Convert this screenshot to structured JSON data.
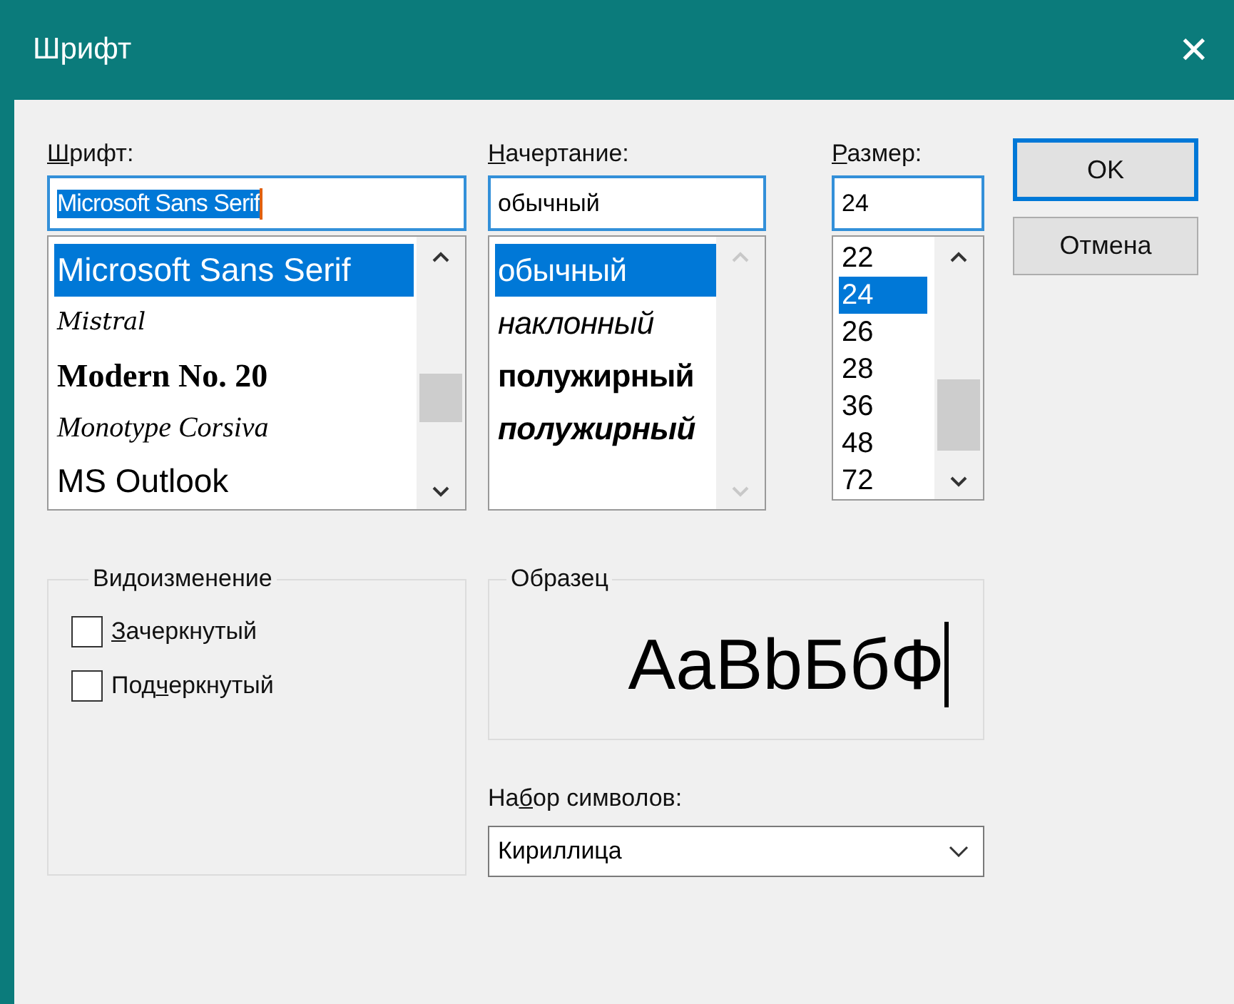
{
  "window": {
    "title": "Шрифт",
    "close": "✕"
  },
  "font": {
    "label": {
      "key": "Ш",
      "rest": "рифт:"
    },
    "value": "Microsoft Sans Serif",
    "items": [
      {
        "text": "Microsoft Sans Serif",
        "kind": "sans",
        "selected": true
      },
      {
        "text": "Mistral",
        "kind": "script",
        "selected": false
      },
      {
        "text": "Modern No. 20",
        "kind": "serif",
        "selected": false
      },
      {
        "text": "Monotype Corsiva",
        "kind": "cursive",
        "selected": false
      },
      {
        "text": "MS Outlook",
        "kind": "sans",
        "selected": false
      }
    ]
  },
  "style": {
    "label": {
      "key": "Н",
      "rest": "ачертание:"
    },
    "value": "обычный",
    "items": [
      {
        "text": "обычный",
        "kind": "regular",
        "selected": true
      },
      {
        "text": "наклонный",
        "kind": "italic",
        "selected": false
      },
      {
        "text": "полужирный",
        "kind": "bold",
        "selected": false
      },
      {
        "text": "полужирный",
        "kind": "bold-italic",
        "selected": false
      }
    ]
  },
  "size": {
    "label": {
      "key": "Р",
      "rest": "азмер:"
    },
    "value": "24",
    "items": [
      {
        "text": "22",
        "selected": false
      },
      {
        "text": "24",
        "selected": true
      },
      {
        "text": "26",
        "selected": false
      },
      {
        "text": "28",
        "selected": false
      },
      {
        "text": "36",
        "selected": false
      },
      {
        "text": "48",
        "selected": false
      },
      {
        "text": "72",
        "selected": false
      }
    ]
  },
  "buttons": [
    {
      "label": "OK",
      "default": true
    },
    {
      "label": "Отмена",
      "default": false
    }
  ],
  "effects": {
    "title": "Видоизменение",
    "options": [
      {
        "label": {
          "key": "З",
          "rest": "ачеркнутый"
        },
        "checked": false
      },
      {
        "label": {
          "lead": "Под",
          "key": "ч",
          "rest": "еркнутый"
        },
        "checked": false
      }
    ]
  },
  "sample": {
    "title": "Образец",
    "text": "AaBbБбФ"
  },
  "charset": {
    "label": {
      "lead": "На",
      "key": "б",
      "rest": "ор символов:"
    },
    "value": "Кириллица"
  }
}
